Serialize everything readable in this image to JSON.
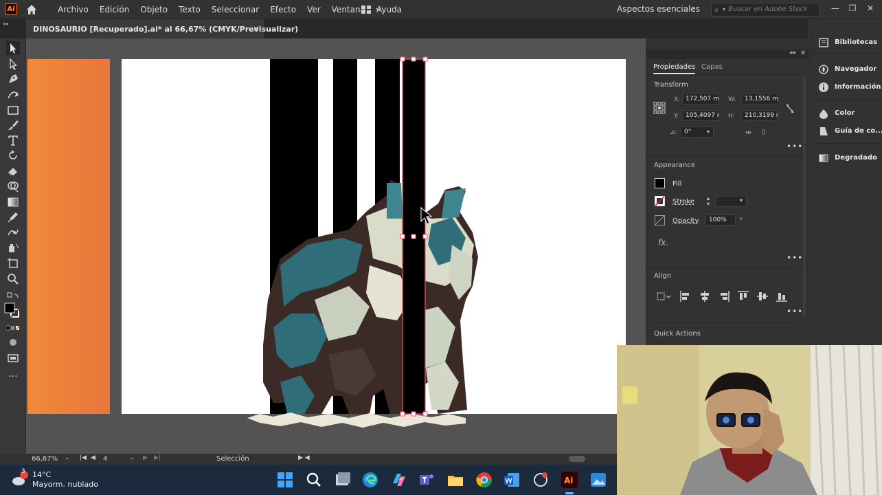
{
  "app": {
    "logo": "Ai",
    "menu": [
      "Archivo",
      "Edición",
      "Objeto",
      "Texto",
      "Seleccionar",
      "Efecto",
      "Ver",
      "Ventana",
      "Ayuda"
    ],
    "workspace": "Aspectos esenciales",
    "search_placeholder": "Buscar en Adobe Stock",
    "window_controls": {
      "minimize": "—",
      "restore": "❐",
      "close": "✕"
    }
  },
  "document_tab": {
    "title": "DINOSAURIO [Recuperado].ai* al 66,67% (CMYK/Previsualizar)",
    "close": "×"
  },
  "tools": [
    "selection-tool",
    "direct-selection-tool",
    "pen-tool",
    "curvature-tool",
    "rectangle-tool",
    "paintbrush-tool",
    "type-tool",
    "rotate-tool",
    "eraser-tool",
    "shape-builder-tool",
    "gradient-tool",
    "eyedropper-tool",
    "puppet-warp-tool",
    "symbol-sprayer-tool",
    "artboard-tool",
    "zoom-tool"
  ],
  "status": {
    "zoom": "66,67%",
    "artboard_number": "4",
    "current_tool": "Selección"
  },
  "properties": {
    "tabs": [
      "Propiedades",
      "Capas"
    ],
    "transform": {
      "title": "Transform",
      "x_label": "X:",
      "x": "172,507 mr",
      "y_label": "Y:",
      "y": "105,4097 r",
      "w_label": "W:",
      "w": "13,1556 mr",
      "h_label": "H:",
      "h": "210,3199 r",
      "rotation_label": "⊿:",
      "rotation": "0°"
    },
    "appearance": {
      "title": "Appearance",
      "fill_label": "Fill",
      "stroke_label": "Stroke",
      "opacity_label": "Opacity",
      "opacity": "100%",
      "fx": "fx."
    },
    "align_title": "Align",
    "quick_actions_title": "Quick Actions",
    "more": "•••"
  },
  "dock": [
    {
      "label": "Bibliotecas",
      "icon": "libraries-icon"
    },
    {
      "label": "Navegador",
      "icon": "navigator-icon"
    },
    {
      "label": "Información",
      "icon": "info-icon"
    },
    {
      "label": "Color",
      "icon": "color-icon"
    },
    {
      "label": "Guía de co...",
      "icon": "color-guide-icon"
    },
    {
      "label": "Degradado",
      "icon": "gradient-icon"
    }
  ],
  "taskbar": {
    "weather_badge": "3",
    "temperature": "14°C",
    "weather": "Mayorm. nublado",
    "apps": [
      "start-icon",
      "search-icon",
      "task-view-icon",
      "edge-icon",
      "copilot-icon",
      "teams-icon",
      "file-explorer-icon",
      "chrome-icon",
      "word-icon",
      "snipping-icon",
      "illustrator-icon",
      "photos-icon"
    ]
  },
  "colors": {
    "accent": "#ff9a00",
    "artboard_orange": "#ed7f3b",
    "selection": "#ff4f6d"
  }
}
